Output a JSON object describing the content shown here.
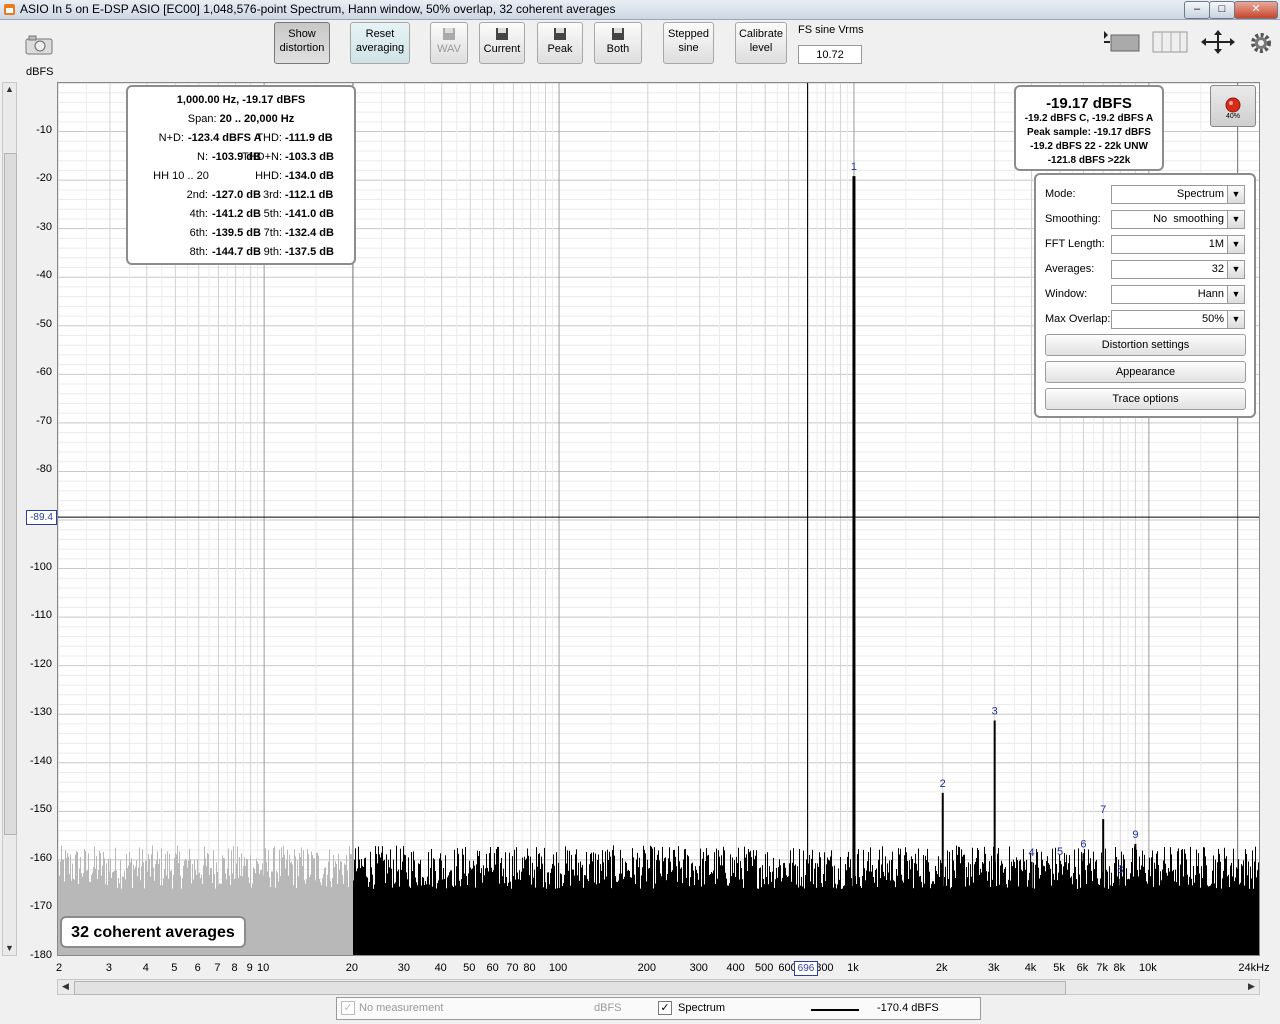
{
  "window": {
    "title": "ASIO In 5 on E-DSP ASIO [EC00] 1,048,576-point Spectrum, Hann window, 50% overlap, 32 coherent averages",
    "buttons": [
      "–",
      "□",
      "✕"
    ]
  },
  "toolbar": {
    "show_distortion": [
      "Show",
      "distortion"
    ],
    "reset_averaging": [
      "Reset",
      "averaging"
    ],
    "wav": "WAV",
    "current": "Current",
    "peak": "Peak",
    "both": "Both",
    "stepped_sine": [
      "Stepped",
      "sine"
    ],
    "calibrate_level": [
      "Calibrate",
      "level"
    ],
    "fs_label": "FS sine Vrms",
    "fs_value": "10.72"
  },
  "axes": {
    "y_unit": "dBFS",
    "y_ticks": [
      "-10",
      "-20",
      "-30",
      "-40",
      "-50",
      "-60",
      "-70",
      "-80",
      "-90",
      "-100",
      "-110",
      "-120",
      "-130",
      "-140",
      "-150",
      "-160",
      "-170",
      "-180"
    ],
    "x_ticks": [
      {
        "v": 2,
        "t": "2"
      },
      {
        "v": 3,
        "t": "3"
      },
      {
        "v": 4,
        "t": "4"
      },
      {
        "v": 5,
        "t": "5"
      },
      {
        "v": 6,
        "t": "6"
      },
      {
        "v": 7,
        "t": "7"
      },
      {
        "v": 8,
        "t": "8"
      },
      {
        "v": 9,
        "t": "9"
      },
      {
        "v": 10,
        "t": "10"
      },
      {
        "v": 20,
        "t": "20"
      },
      {
        "v": 30,
        "t": "30"
      },
      {
        "v": 40,
        "t": "40"
      },
      {
        "v": 50,
        "t": "50"
      },
      {
        "v": 60,
        "t": "60"
      },
      {
        "v": 70,
        "t": "70"
      },
      {
        "v": 80,
        "t": "80"
      },
      {
        "v": 100,
        "t": "100"
      },
      {
        "v": 200,
        "t": "200"
      },
      {
        "v": 300,
        "t": "300"
      },
      {
        "v": 400,
        "t": "400"
      },
      {
        "v": 500,
        "t": "500"
      },
      {
        "v": 600,
        "t": "600"
      },
      {
        "v": 800,
        "t": "800"
      },
      {
        "v": 1000,
        "t": "1k"
      },
      {
        "v": 2000,
        "t": "2k"
      },
      {
        "v": 3000,
        "t": "3k"
      },
      {
        "v": 4000,
        "t": "4k"
      },
      {
        "v": 5000,
        "t": "5k"
      },
      {
        "v": 6000,
        "t": "6k"
      },
      {
        "v": 7000,
        "t": "7k"
      },
      {
        "v": 8000,
        "t": "8k"
      },
      {
        "v": 10000,
        "t": "10k"
      },
      {
        "v": 24000,
        "t": "24kHz"
      }
    ],
    "y_cursor": "-89.4",
    "x_cursor": "696"
  },
  "distortion": {
    "header1": "1,000.00 Hz, -19.17 dBFS",
    "span_label": "Span:",
    "span_value": "20 .. 20,000 Hz",
    "rows": [
      {
        "l1": "N+D:",
        "v1": "-123.4 dBFS A",
        "l2": "THD:",
        "v2": "-111.9 dB"
      },
      {
        "l1": "N:",
        "v1": "-103.9 dB",
        "l2": "THD+N:",
        "v2": "-103.3 dB"
      },
      {
        "l1": "HH 10 .. 20",
        "v1": "",
        "l2": "HHD:",
        "v2": "-134.0 dB"
      },
      {
        "l1": "2nd:",
        "v1": "-127.0 dB",
        "l2": "3rd:",
        "v2": "-112.1 dB"
      },
      {
        "l1": "4th:",
        "v1": "-141.2 dB",
        "l2": "5th:",
        "v2": "-141.0 dB"
      },
      {
        "l1": "6th:",
        "v1": "-139.5 dB",
        "l2": "7th:",
        "v2": "-132.4 dB"
      },
      {
        "l1": "8th:",
        "v1": "-144.7 dB",
        "l2": "9th:",
        "v2": "-137.5 dB"
      }
    ]
  },
  "level": {
    "main": "-19.17 dBFS",
    "line1": "-19.2 dBFS C, -19.2 dBFS A",
    "line2": "Peak sample: -19.17 dBFS",
    "line3": "-19.2 dBFS 22 - 22k UNW",
    "line4": "-121.8 dBFS >22k"
  },
  "record": {
    "label": "40%"
  },
  "controls": {
    "mode": {
      "label": "Mode:",
      "value": "Spectrum"
    },
    "smoothing": {
      "label": "Smoothing:",
      "value": "No  smoothing"
    },
    "fft": {
      "label": "FFT Length:",
      "value": "1M"
    },
    "averages": {
      "label": "Averages:",
      "value": "32"
    },
    "window": {
      "label": "Window:",
      "value": "Hann"
    },
    "overlap": {
      "label": "Max Overlap:",
      "value": "50%"
    },
    "distortion_settings": "Distortion settings",
    "appearance": "Appearance",
    "trace_options": "Trace options"
  },
  "avg_overlay": "32 coherent averages",
  "legend": {
    "no_measurement": "No measurement",
    "unit1": "dBFS",
    "spectrum": "Spectrum",
    "value": "-170.4 dBFS"
  },
  "chart_data": {
    "type": "line",
    "xscale": "log",
    "xlim": [
      2,
      24000
    ],
    "ylim": [
      -180,
      0
    ],
    "ylabel": "dBFS",
    "noise_floor_dbfs": -170,
    "peaks": [
      {
        "label": "1",
        "freq": 1000,
        "db": -19.17
      },
      {
        "label": "2",
        "freq": 2000,
        "db": -146.2
      },
      {
        "label": "3",
        "freq": 3000,
        "db": -131.3
      },
      {
        "label": "4",
        "freq": 4000,
        "db": -160.4
      },
      {
        "label": "5",
        "freq": 5000,
        "db": -160.2
      },
      {
        "label": "6",
        "freq": 6000,
        "db": -158.7
      },
      {
        "label": "7",
        "freq": 7000,
        "db": -151.6
      },
      {
        "label": "8",
        "freq": 8000,
        "db": -163.9
      },
      {
        "label": "9",
        "freq": 9000,
        "db": -156.7
      }
    ],
    "grid": true
  },
  "colors": {
    "trace": "#000000",
    "trace_below20": "#b8b8b8",
    "marker": "#1f2f9a",
    "grid": "#d8d8d8",
    "record": "#d92b1a"
  }
}
